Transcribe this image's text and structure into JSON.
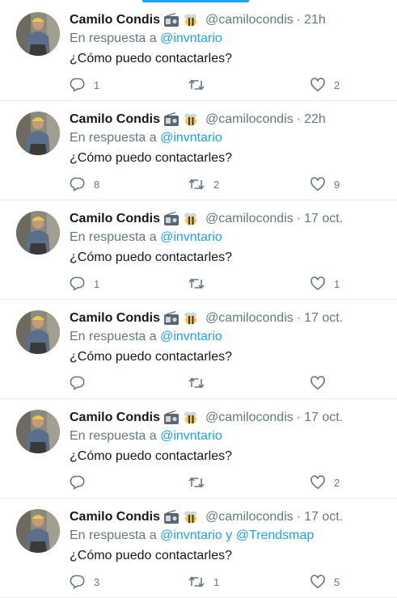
{
  "author": {
    "name": "Camilo Condis",
    "handle": "@camilocondis",
    "emoji_icons": [
      "radio-icon",
      "bee-icon"
    ]
  },
  "reply_prefix": "En respuesta a",
  "separator": "·",
  "colors": {
    "link": "#1da1f2",
    "muted": "#657786",
    "text": "#14171a",
    "divider": "#e6ecf0"
  },
  "tweets": [
    {
      "time": "21h",
      "reply_to": "@invntario",
      "reply_and": "",
      "reply_to_2": "",
      "text": "¿Cómo puedo contactarles?",
      "replies": "1",
      "retweets": "",
      "likes": "2"
    },
    {
      "time": "22h",
      "reply_to": "@invntario",
      "reply_and": "",
      "reply_to_2": "",
      "text": "¿Cómo puedo contactarles?",
      "replies": "8",
      "retweets": "2",
      "likes": "9"
    },
    {
      "time": "17 oct.",
      "reply_to": "@invntario",
      "reply_and": "",
      "reply_to_2": "",
      "text": "¿Cómo puedo contactarles?",
      "replies": "1",
      "retweets": "",
      "likes": "1"
    },
    {
      "time": "17 oct.",
      "reply_to": "@invntario",
      "reply_and": "",
      "reply_to_2": "",
      "text": "¿Cómo puedo contactarles?",
      "replies": "",
      "retweets": "",
      "likes": ""
    },
    {
      "time": "17 oct.",
      "reply_to": "@invntario",
      "reply_and": "",
      "reply_to_2": "",
      "text": "¿Cómo puedo contactarles?",
      "replies": "",
      "retweets": "",
      "likes": "2"
    },
    {
      "time": "17 oct.",
      "reply_to": "@invntario",
      "reply_and": "y",
      "reply_to_2": "@Trendsmap",
      "text": "¿Cómo puedo contactarles?",
      "replies": "3",
      "retweets": "1",
      "likes": "5"
    }
  ]
}
